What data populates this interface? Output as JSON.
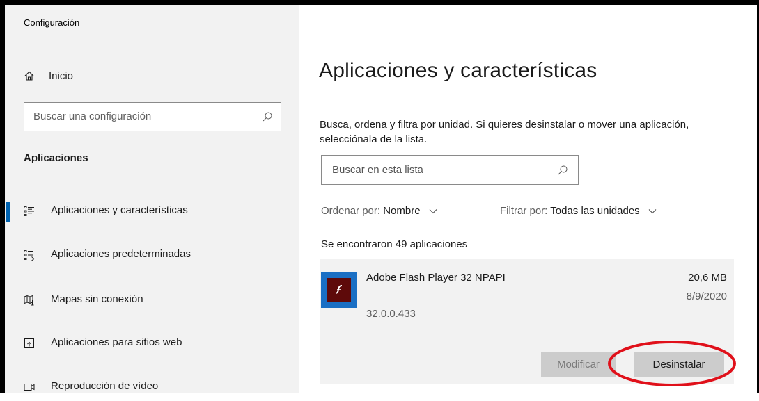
{
  "window": {
    "title": "Configuración"
  },
  "sidebar": {
    "home_label": "Inicio",
    "search_placeholder": "Buscar una configuración",
    "section_title": "Aplicaciones",
    "items": [
      {
        "label": "Aplicaciones y características",
        "icon": "apps-features-icon",
        "selected": true
      },
      {
        "label": "Aplicaciones predeterminadas",
        "icon": "default-apps-icon",
        "selected": false
      },
      {
        "label": "Mapas sin conexión",
        "icon": "offline-maps-icon",
        "selected": false
      },
      {
        "label": "Aplicaciones para sitios web",
        "icon": "apps-websites-icon",
        "selected": false
      },
      {
        "label": "Reproducción de vídeo",
        "icon": "video-playback-icon",
        "selected": false
      }
    ]
  },
  "main": {
    "title": "Aplicaciones y características",
    "description": "Busca, ordena y filtra por unidad. Si quieres desinstalar o mover una aplicación, selecciónala de la lista.",
    "list_search_placeholder": "Buscar en esta lista",
    "sort": {
      "label": "Ordenar por:",
      "value": "Nombre"
    },
    "filter": {
      "label": "Filtrar por:",
      "value": "Todas las unidades"
    },
    "count_text": "Se encontraron 49 aplicaciones",
    "selected_app": {
      "name": "Adobe Flash Player 32 NPAPI",
      "size": "20,6 MB",
      "date": "8/9/2020",
      "version": "32.0.0.433",
      "modify_label": "Modificar",
      "uninstall_label": "Desinstalar"
    }
  },
  "colors": {
    "accent": "#0063b1",
    "sidebar_bg": "#f2f2f2",
    "annotation": "#e0101a",
    "flash_icon_bg": "#1a6fc4",
    "flash_icon_inner": "#5e0a0a"
  }
}
